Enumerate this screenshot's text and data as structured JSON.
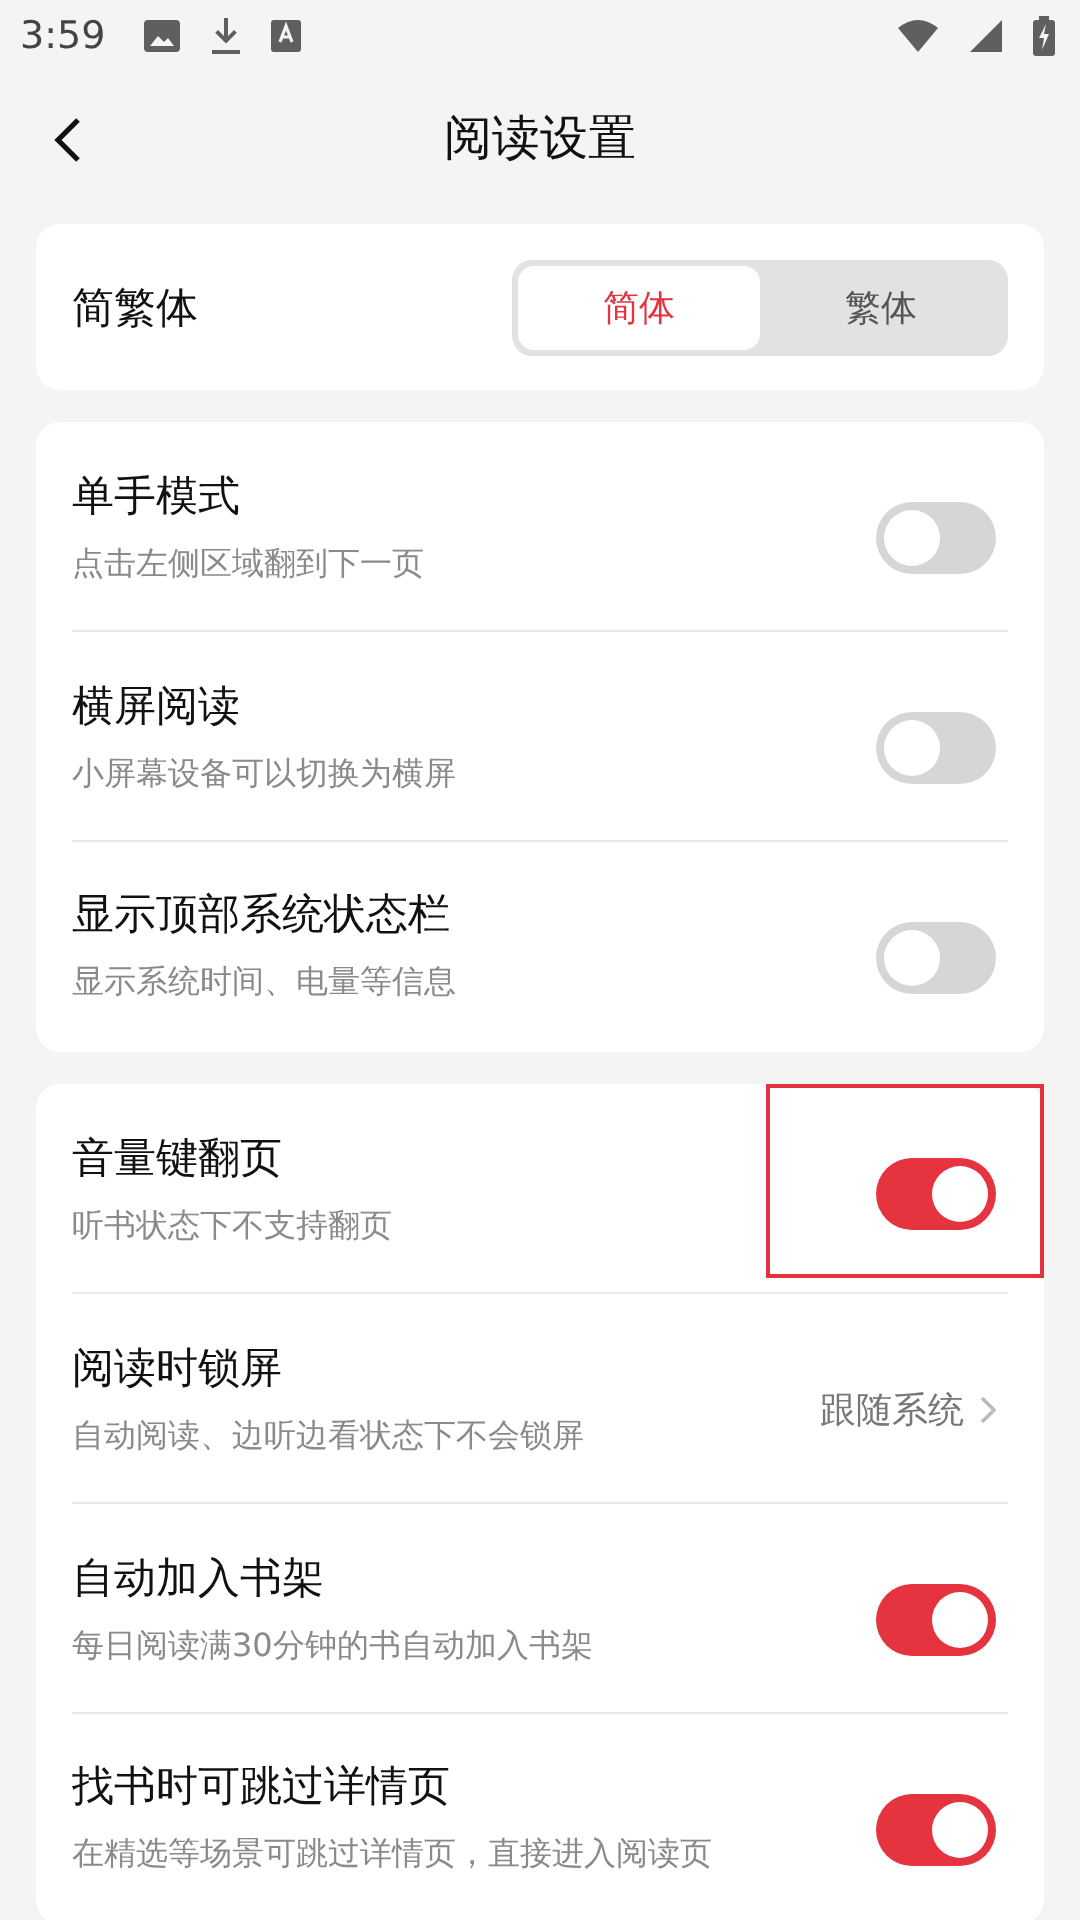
{
  "status_bar": {
    "time": "3:59"
  },
  "header": {
    "title": "阅读设置"
  },
  "script_card": {
    "label": "简繁体",
    "options": [
      {
        "label": "简体",
        "selected": true
      },
      {
        "label": "繁体",
        "selected": false
      }
    ]
  },
  "groups": [
    {
      "rows": [
        {
          "kind": "toggle",
          "title": "单手模式",
          "subtitle": "点击左侧区域翻到下一页",
          "on": false,
          "highlighted": false
        },
        {
          "kind": "toggle",
          "title": "横屏阅读",
          "subtitle": "小屏幕设备可以切换为横屏",
          "on": false,
          "highlighted": false
        },
        {
          "kind": "toggle",
          "title": "显示顶部系统状态栏",
          "subtitle": "显示系统时间、电量等信息",
          "on": false,
          "highlighted": false
        }
      ]
    },
    {
      "rows": [
        {
          "kind": "toggle",
          "title": "音量键翻页",
          "subtitle": "听书状态下不支持翻页",
          "on": true,
          "highlighted": true
        },
        {
          "kind": "link",
          "title": "阅读时锁屏",
          "subtitle": "自动阅读、边听边看状态下不会锁屏",
          "value": "跟随系统",
          "highlighted": false
        },
        {
          "kind": "toggle",
          "title": "自动加入书架",
          "subtitle": "每日阅读满30分钟的书自动加入书架",
          "on": true,
          "highlighted": false
        },
        {
          "kind": "toggle",
          "title": "找书时可跳过详情页",
          "subtitle": "在精选等场景可跳过详情页，直接进入阅读页",
          "on": true,
          "highlighted": false
        }
      ]
    }
  ]
}
